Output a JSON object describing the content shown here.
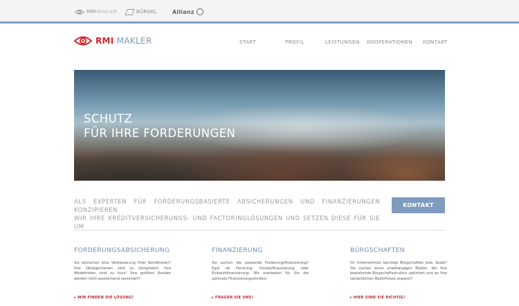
{
  "partners": {
    "rmi": {
      "name": "RMI",
      "suffix": "MAKLER"
    },
    "burgel": {
      "name": "BÜRGEL"
    },
    "allianz": {
      "name": "Allianz"
    }
  },
  "header": {
    "logo": {
      "brand": "RMI",
      "suffix": "MAKLER"
    },
    "nav": [
      "START",
      "PROFIL",
      "LEISTUNGEN",
      "KOOPERATIONEN",
      "KONTAKT"
    ]
  },
  "hero": {
    "title_line1": "SCHUTZ",
    "title_line2": "FÜR IHRE FORDERUNGEN"
  },
  "intro": {
    "line1": "ALS EXPERTEN FÜR FORDERUNGSBASIERTE ABSICHERUNGEN UND FINANZIERUNGEN KONZIPIEREN",
    "line2": "WIR IHRE KREDITVERSICHERUNGS- UND FACTORINGLÖSUNGEN UND SETZEN DIESE FÜR SIE UM",
    "cta_label": "KONTAKT"
  },
  "columns": [
    {
      "title": "FORDERUNGSABSICHERUNG",
      "text": "Sie wünschen eine Verbesserung Ihrer Konditionen? Ihre Obliegenheiten sind zu kompliziert. Ihre Meldefristen sind zu kurz? Ihre größten Kunden werden nicht ausreichend versichert?",
      "link": "▸ WIR FINDEN DIE LÖSUNG!"
    },
    {
      "title": "FINANZIERUNG",
      "text": "Sie suchen die passende Forderungsfinanzierung? Egal ob Factoring, Umsatzfinanzierung oder Einkaufsfinanzierung. Wir erarbeiten für Sie die optimale Finanzierungsstruktur.",
      "link": "▸ FRAGEN SIE UNS!"
    },
    {
      "title": "BÜRGSCHAFTEN",
      "text": "Ihr Unternehmen benötigt Bürgschaften bzw. Avale? Sie suchen einen unabhängigen Makler, der Ihre bestehende Bürgschaftsstruktur optimiert und an Ihre tatsächlichen Bedürfnisse anpasst?",
      "link": "▸ HIER SIND SIE RICHTIG!"
    }
  ],
  "colors": {
    "accent": "#7f9cbf",
    "brand_red": "#d4232a",
    "link_red": "#c0272d"
  }
}
